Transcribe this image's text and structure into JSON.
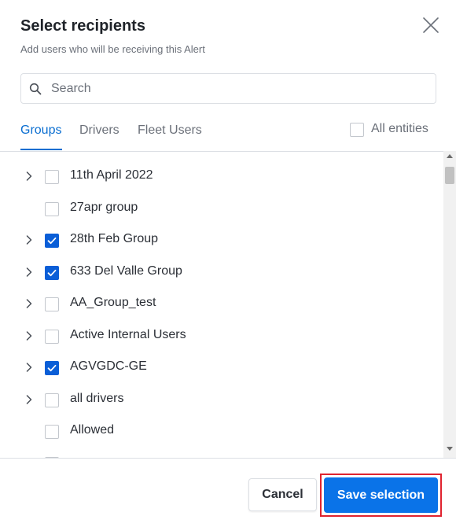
{
  "dialog": {
    "title": "Select recipients",
    "subtitle": "Add users who will be receiving this Alert"
  },
  "search": {
    "placeholder": "Search",
    "value": ""
  },
  "tabs": [
    {
      "label": "Groups",
      "active": true
    },
    {
      "label": "Drivers",
      "active": false
    },
    {
      "label": "Fleet Users",
      "active": false
    }
  ],
  "all_entities": {
    "label": "All entities",
    "checked": false
  },
  "groups": [
    {
      "label": "11th April 2022",
      "checked": false,
      "expandable": true
    },
    {
      "label": "27apr group",
      "checked": false,
      "expandable": false
    },
    {
      "label": "28th Feb Group",
      "checked": true,
      "expandable": true
    },
    {
      "label": "633 Del Valle Group",
      "checked": true,
      "expandable": true
    },
    {
      "label": "AA_Group_test",
      "checked": false,
      "expandable": true
    },
    {
      "label": "Active Internal Users",
      "checked": false,
      "expandable": true
    },
    {
      "label": "AGVGDC-GE",
      "checked": true,
      "expandable": true
    },
    {
      "label": "all drivers",
      "checked": false,
      "expandable": true
    },
    {
      "label": "Allowed",
      "checked": false,
      "expandable": false
    },
    {
      "label": "",
      "checked": false,
      "expandable": false
    }
  ],
  "footer": {
    "cancel_label": "Cancel",
    "save_label": "Save selection"
  },
  "colors": {
    "accent": "#0a6ed1",
    "primary_button": "#0a73e8",
    "checkbox_checked": "#0a5ed7",
    "highlight": "#e0232f"
  },
  "icons": {
    "close": "close-icon",
    "search": "search-icon",
    "expand": "chevron-right-icon",
    "check": "check-icon"
  }
}
